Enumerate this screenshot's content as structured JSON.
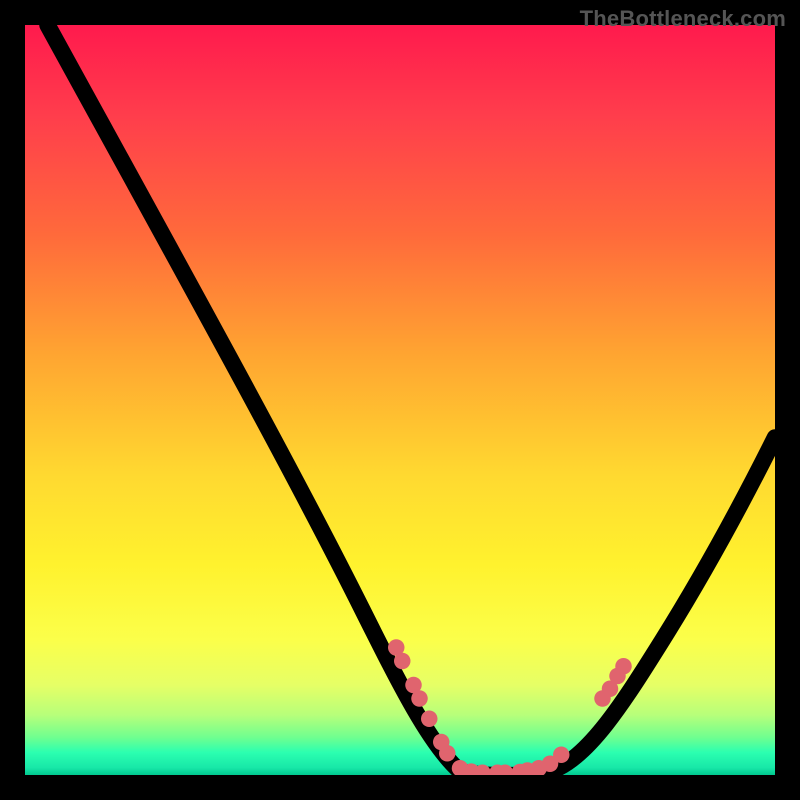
{
  "watermark": "TheBottleneck.com",
  "chart_data": {
    "type": "line",
    "title": "",
    "xlabel": "",
    "ylabel": "",
    "xlim": [
      0,
      100
    ],
    "ylim": [
      0,
      100
    ],
    "grid": false,
    "legend": null,
    "series": [
      {
        "name": "bottleneck-curve",
        "x": [
          3,
          58,
          70,
          100
        ],
        "y": [
          100,
          0,
          0,
          45
        ],
        "color": "#000000"
      }
    ],
    "markers": [
      {
        "x": 49.5,
        "y": 17.0
      },
      {
        "x": 50.3,
        "y": 15.2
      },
      {
        "x": 51.8,
        "y": 12.0
      },
      {
        "x": 52.6,
        "y": 10.2
      },
      {
        "x": 53.9,
        "y": 7.5
      },
      {
        "x": 55.5,
        "y": 4.4
      },
      {
        "x": 56.3,
        "y": 2.9
      },
      {
        "x": 58.0,
        "y": 0.9
      },
      {
        "x": 59.5,
        "y": 0.45
      },
      {
        "x": 61.0,
        "y": 0.3
      },
      {
        "x": 63.0,
        "y": 0.3
      },
      {
        "x": 64.0,
        "y": 0.3
      },
      {
        "x": 66.0,
        "y": 0.4
      },
      {
        "x": 67.0,
        "y": 0.6
      },
      {
        "x": 68.5,
        "y": 0.9
      },
      {
        "x": 70.0,
        "y": 1.5
      },
      {
        "x": 71.5,
        "y": 2.7
      },
      {
        "x": 77.0,
        "y": 10.2
      },
      {
        "x": 78.0,
        "y": 11.5
      },
      {
        "x": 79.0,
        "y": 13.2
      },
      {
        "x": 79.8,
        "y": 14.5
      }
    ],
    "gradient_stops": [
      {
        "pos": 0,
        "color": "#ff1a4d"
      },
      {
        "pos": 12,
        "color": "#ff3d4c"
      },
      {
        "pos": 28,
        "color": "#ff6a3b"
      },
      {
        "pos": 44,
        "color": "#ffa531"
      },
      {
        "pos": 60,
        "color": "#ffd930"
      },
      {
        "pos": 72,
        "color": "#fff22e"
      },
      {
        "pos": 82,
        "color": "#fbff4a"
      },
      {
        "pos": 88,
        "color": "#e6ff66"
      },
      {
        "pos": 92,
        "color": "#b7ff7a"
      },
      {
        "pos": 95,
        "color": "#6fff90"
      },
      {
        "pos": 97,
        "color": "#2bffb0"
      },
      {
        "pos": 99,
        "color": "#18e8a8"
      },
      {
        "pos": 100,
        "color": "#00c98f"
      }
    ],
    "marker_color": "#e0646e",
    "marker_radius_pct": 1.1
  }
}
